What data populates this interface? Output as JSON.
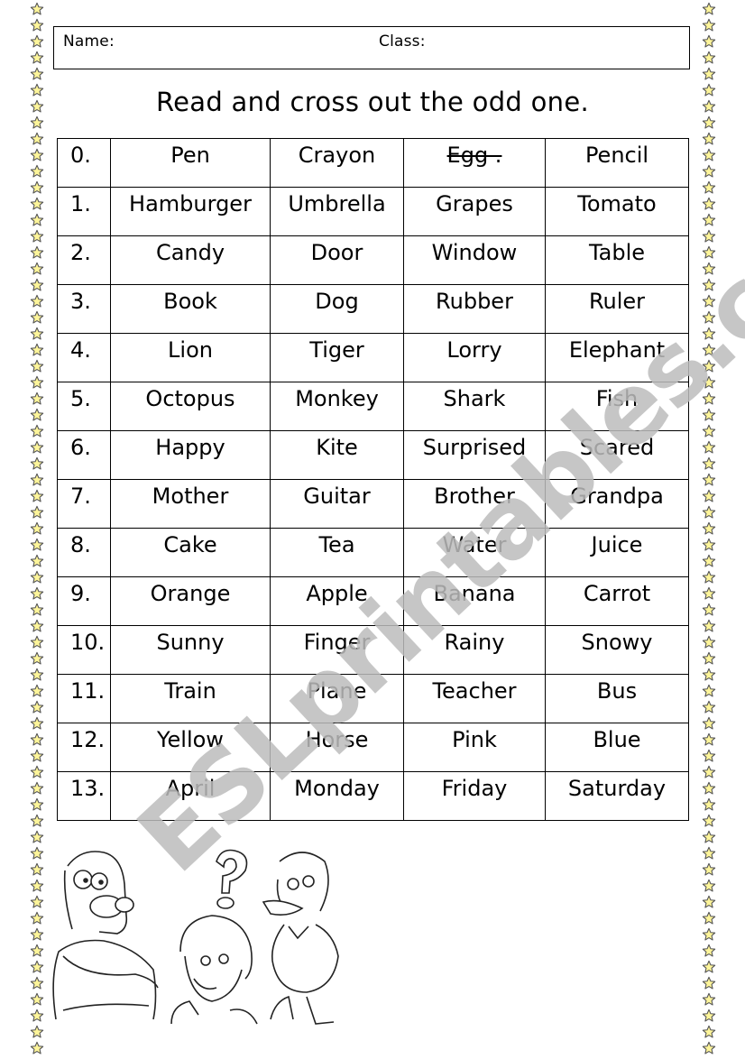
{
  "worksheet": {
    "header": {
      "name_label": "Name:",
      "class_label": "Class:"
    },
    "instructions": "Read and cross out the odd one.",
    "rows": [
      {
        "num": "0.",
        "words": [
          "Pen",
          "Crayon",
          "Egg .",
          "Pencil"
        ],
        "crossed_out_index": 2
      },
      {
        "num": "1.",
        "words": [
          "Hamburger",
          "Umbrella",
          "Grapes",
          "Tomato"
        ]
      },
      {
        "num": "2.",
        "words": [
          "Candy",
          "Door",
          "Window",
          "Table"
        ]
      },
      {
        "num": "3.",
        "words": [
          "Book",
          "Dog",
          "Rubber",
          "Ruler"
        ]
      },
      {
        "num": "4.",
        "words": [
          "Lion",
          "Tiger",
          "Lorry",
          "Elephant"
        ]
      },
      {
        "num": "5.",
        "words": [
          "Octopus",
          "Monkey",
          "Shark",
          "Fish"
        ]
      },
      {
        "num": "6.",
        "words": [
          "Happy",
          "Kite",
          "Surprised",
          "Scared"
        ]
      },
      {
        "num": "7.",
        "words": [
          "Mother",
          "Guitar",
          "Brother",
          "Grandpa"
        ]
      },
      {
        "num": "8.",
        "words": [
          "Cake",
          "Tea",
          "Water",
          "Juice"
        ]
      },
      {
        "num": "9.",
        "words": [
          "Orange",
          "Apple",
          "Banana",
          "Carrot"
        ]
      },
      {
        "num": "10.",
        "words": [
          "Sunny",
          "Finger",
          "Rainy",
          "Snowy"
        ]
      },
      {
        "num": "11.",
        "words": [
          "Train",
          "Plane",
          "Teacher",
          "Bus"
        ]
      },
      {
        "num": "12.",
        "words": [
          "Yellow",
          "Horse",
          "Pink",
          "Blue"
        ]
      },
      {
        "num": "13.",
        "words": [
          "April",
          "Monday",
          "Friday",
          "Saturday"
        ]
      }
    ],
    "watermark": "ESLprintables.com",
    "illustration": {
      "characters": [
        "homer-simpson-thinking",
        "child-thinking",
        "donald-duck-thinking"
      ],
      "symbol": "?"
    },
    "border": {
      "icon": "star-icon",
      "fill_color": "#fdf59a",
      "stroke_color": "#555555"
    }
  }
}
